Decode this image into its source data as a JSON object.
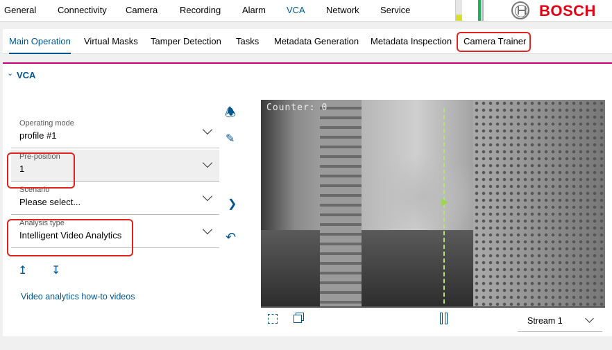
{
  "top_nav": {
    "tabs": [
      "General",
      "Connectivity",
      "Camera",
      "Recording",
      "Alarm",
      "VCA",
      "Network",
      "Service"
    ],
    "active": "VCA",
    "logo": "BOSCH"
  },
  "sub_nav": {
    "tabs": [
      "Main Operation",
      "Virtual Masks",
      "Tamper Detection",
      "Tasks",
      "Metadata Generation",
      "Metadata Inspection",
      "Camera Trainer"
    ],
    "active": "Main Operation"
  },
  "section": {
    "title": "VCA"
  },
  "fields": [
    {
      "label": "Operating mode",
      "value": "profile #1"
    },
    {
      "label": "Pre-position",
      "value": "1"
    },
    {
      "label": "Scenario",
      "value": "Please select..."
    },
    {
      "label": "Analysis type",
      "value": "Intelligent Video Analytics"
    }
  ],
  "link": "Video analytics how-to videos",
  "video": {
    "counter": "Counter: 0",
    "stream": "Stream 1"
  },
  "colors": {
    "accent": "#005691",
    "brand": "#e20015",
    "divider": "#c8007a",
    "highlight": "#e2221c"
  }
}
